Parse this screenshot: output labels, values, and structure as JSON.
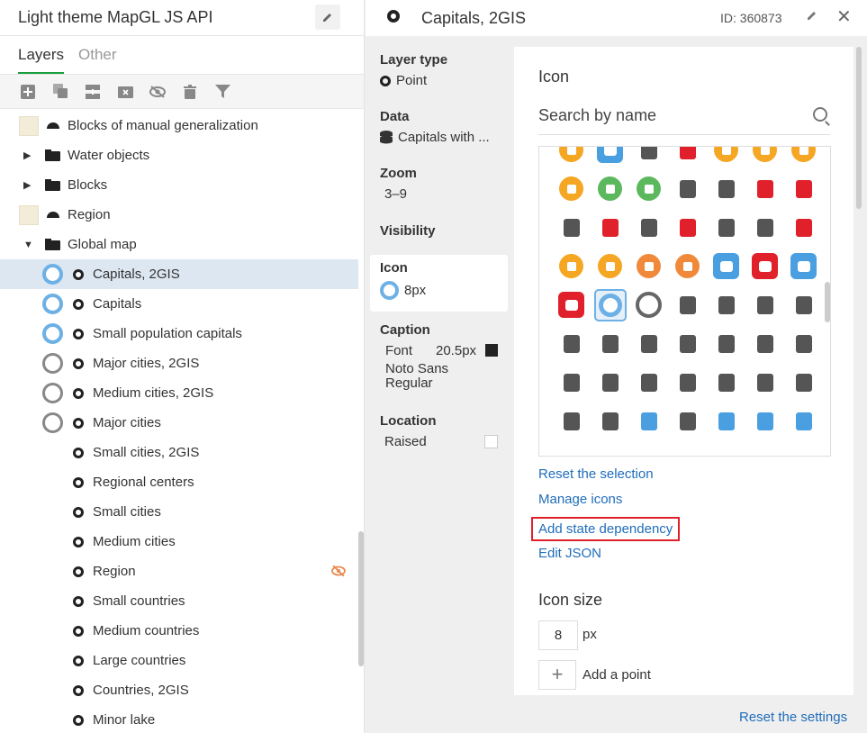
{
  "app": {
    "title": "Light theme MapGL JS API"
  },
  "tabs": [
    "Layers",
    "Other"
  ],
  "toolbar": [
    "add-layer-icon",
    "duplicate-icon",
    "group-icon",
    "delete-folder-icon",
    "hide-icon",
    "trash-icon",
    "filter-icon"
  ],
  "layers": [
    {
      "label": "Blocks of manual generalization",
      "kind": "fill"
    },
    {
      "label": "Water objects",
      "kind": "folder"
    },
    {
      "label": "Blocks",
      "kind": "folder"
    },
    {
      "label": "Region",
      "kind": "fill"
    },
    {
      "label": "Global map",
      "kind": "folder-open"
    },
    {
      "label": "Capitals, 2GIS",
      "kind": "point-blue",
      "selected": true
    },
    {
      "label": "Capitals",
      "kind": "point-blue"
    },
    {
      "label": "Small population capitals",
      "kind": "point-blue"
    },
    {
      "label": "Major cities, 2GIS",
      "kind": "point-gray"
    },
    {
      "label": "Medium cities, 2GIS",
      "kind": "point-gray"
    },
    {
      "label": "Major cities",
      "kind": "point-gray"
    },
    {
      "label": "Small cities, 2GIS",
      "kind": "point"
    },
    {
      "label": "Regional centers",
      "kind": "point"
    },
    {
      "label": "Small cities",
      "kind": "point"
    },
    {
      "label": "Medium cities",
      "kind": "point"
    },
    {
      "label": "Region",
      "kind": "point",
      "hidden": true
    },
    {
      "label": "Small countries",
      "kind": "point"
    },
    {
      "label": "Medium countries",
      "kind": "point"
    },
    {
      "label": "Large countries",
      "kind": "point"
    },
    {
      "label": "Countries, 2GIS",
      "kind": "point"
    },
    {
      "label": "Minor lake",
      "kind": "point"
    }
  ],
  "layer_header": {
    "title": "Capitals, 2GIS",
    "id": "ID: 360873"
  },
  "props": {
    "layer_type_label": "Layer type",
    "layer_type_value": "Point",
    "data_label": "Data",
    "data_value": "Capitals with ...",
    "zoom_label": "Zoom",
    "zoom_value": "3–9",
    "visibility_label": "Visibility",
    "icon_label": "Icon",
    "icon_value": "8px",
    "caption_label": "Caption",
    "caption_font_label": "Font",
    "caption_font_size": "20.5px",
    "caption_font_name": "Noto Sans Regular",
    "location_label": "Location",
    "location_value": "Raised"
  },
  "icon_panel": {
    "title": "Icon",
    "search_placeholder": "Search by name",
    "reset_selection": "Reset the selection",
    "manage_icons": "Manage icons",
    "add_state_dependency": "Add state dependency",
    "edit_json": "Edit JSON",
    "icon_size_title": "Icon size",
    "icon_size_value": "8",
    "icon_size_unit": "px",
    "add_point": "Add a point"
  },
  "icon_grid": [
    [
      [
        "theatre-icon",
        "#f5a623",
        "r"
      ],
      [
        "square-icon",
        "#4a9fe0",
        "s"
      ],
      [
        "fuel-icon",
        "#555",
        "n"
      ],
      [
        "drink-icon",
        "#e0202a",
        "n"
      ],
      [
        "pizza-icon",
        "#f5a623",
        "r"
      ],
      [
        "meal-icon",
        "#f5a623",
        "r"
      ],
      [
        "mask-icon",
        "#f5a623",
        "r"
      ]
    ],
    [
      [
        "theatre-masks-icon",
        "#f5a623",
        "r"
      ],
      [
        "toilet-icon",
        "#5cb85c",
        "r"
      ],
      [
        "toilet-filled-icon",
        "#5cb85c",
        "r"
      ],
      [
        "traffic-light-icon",
        "#555",
        "n"
      ],
      [
        "cup-icon",
        "#555",
        "n"
      ],
      [
        "cup-red-icon",
        "#e0202a",
        "n"
      ],
      [
        "people-red-icon",
        "#e0202a",
        "n"
      ]
    ],
    [
      [
        "water-drop-icon",
        "#555",
        "n"
      ],
      [
        "blood-drop-icon",
        "#e0202a",
        "n"
      ],
      [
        "waterfall-icon",
        "#555",
        "n"
      ],
      [
        "waterfall-red-icon",
        "#e0202a",
        "n"
      ],
      [
        "people-icon",
        "#555",
        "n"
      ],
      [
        "snowflake-icon",
        "#555",
        "n"
      ],
      [
        "snowflake-red-icon",
        "#e0202a",
        "n"
      ]
    ],
    [
      [
        "diamond-yellow-icon",
        "#f5a623",
        "r"
      ],
      [
        "diamond-orange-icon",
        "#f5a623",
        "r"
      ],
      [
        "lion-icon",
        "#f08a3a",
        "r"
      ],
      [
        "lion-outline-icon",
        "#f08a3a",
        "r"
      ],
      [
        "ship-blue-icon",
        "#4a9fe0",
        "s"
      ],
      [
        "ship-red-icon",
        "#e0202a",
        "s"
      ],
      [
        "train-blue-icon",
        "#4a9fe0",
        "s"
      ]
    ],
    [
      [
        "train-red-icon",
        "#e0202a",
        "s"
      ],
      [
        "circle-selected-icon",
        "#6cb0e5",
        "sel"
      ],
      [
        "circle-gray-icon",
        "#666",
        "ring"
      ],
      [
        "info-person-icon",
        "#555",
        "n"
      ],
      [
        "card-icon",
        "#555",
        "n"
      ],
      [
        "cart-icon",
        "#555",
        "n"
      ],
      [
        "briefcase-icon",
        "#555",
        "n"
      ]
    ],
    [
      [
        "escalator-icon",
        "#555",
        "n"
      ],
      [
        "border-icon",
        "#555",
        "n"
      ],
      [
        "coins-icon",
        "#555",
        "n"
      ],
      [
        "purse-icon",
        "#555",
        "n"
      ],
      [
        "banknote-icon",
        "#555",
        "n"
      ],
      [
        "helm-icon",
        "#555",
        "n"
      ],
      [
        "case-icon",
        "#555",
        "n"
      ]
    ],
    [
      [
        "taxi-icon",
        "#555",
        "n"
      ],
      [
        "cross-icon",
        "#555",
        "n"
      ],
      [
        "phone-icon",
        "#555",
        "n"
      ],
      [
        "hanger-icon",
        "#555",
        "n"
      ],
      [
        "coffee-icon",
        "#555",
        "n"
      ],
      [
        "glass-icon",
        "#555",
        "n"
      ],
      [
        "dollar-icon",
        "#555",
        "n"
      ]
    ],
    [
      [
        "pin-icon",
        "#555",
        "n"
      ],
      [
        "wheelchair-icon",
        "#555",
        "n"
      ],
      [
        "pipes-icon",
        "#4a9fe0",
        "n"
      ],
      [
        "balloon-icon",
        "#555",
        "n"
      ],
      [
        "escalator-up-icon",
        "#4a9fe0",
        "n"
      ],
      [
        "escalator-down-icon",
        "#4a9fe0",
        "n"
      ],
      [
        "escalator-blue-icon",
        "#4a9fe0",
        "n"
      ]
    ]
  ],
  "footer": {
    "reset_settings": "Reset the settings"
  },
  "colors": {
    "accent_blue": "#1f6dba",
    "selection_blue": "#6cb0e5",
    "tab_green": "#1a9e3f",
    "highlight_red": "#e0202a"
  }
}
